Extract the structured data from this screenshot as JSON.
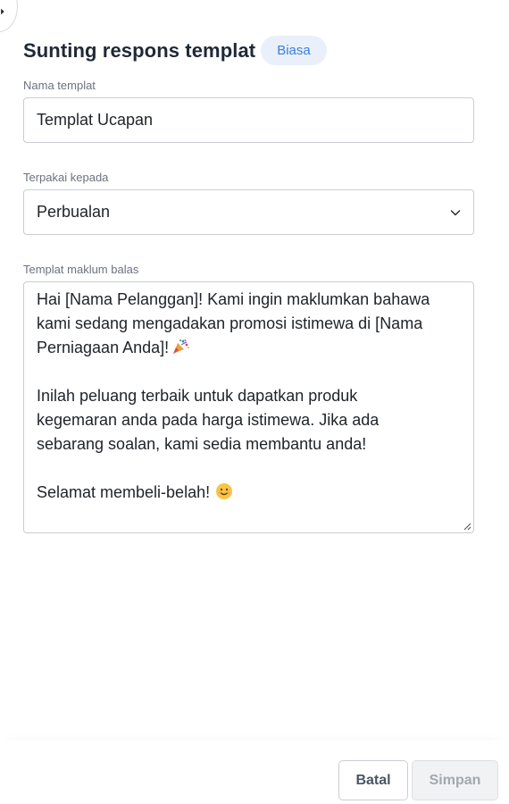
{
  "header": {
    "title": "Sunting respons templat",
    "badge": "Biasa"
  },
  "fields": {
    "name": {
      "label": "Nama templat",
      "value": "Templat Ucapan"
    },
    "applies_to": {
      "label": "Terpakai kepada",
      "selected": "Perbualan"
    },
    "reply_template": {
      "label": "Templat maklum balas",
      "lines": [
        "Hai [Nama Pelanggan]! Kami ingin maklumkan bahawa",
        "kami sedang mengadakan promosi istimewa di [Nama",
        "Perniagaan Anda]!",
        "",
        "Inilah peluang terbaik untuk dapatkan produk",
        "kegemaran anda pada harga istimewa. Jika ada",
        "sebarang soalan, kami sedia membantu anda!",
        "",
        "Selamat membeli-belah!"
      ]
    }
  },
  "footer": {
    "cancel_label": "Batal",
    "save_label": "Simpan"
  },
  "icons": {
    "back": "arrow-left-icon",
    "chevron": "chevron-down-icon",
    "party": "party-popper-icon",
    "smile": "smiling-face-icon",
    "resize": "resize-handle-icon"
  },
  "colors": {
    "badge_bg": "#e9f0fb",
    "badge_text": "#3b7fd9",
    "border": "#c9cdd3",
    "disabled_text": "#a3a8b0"
  }
}
